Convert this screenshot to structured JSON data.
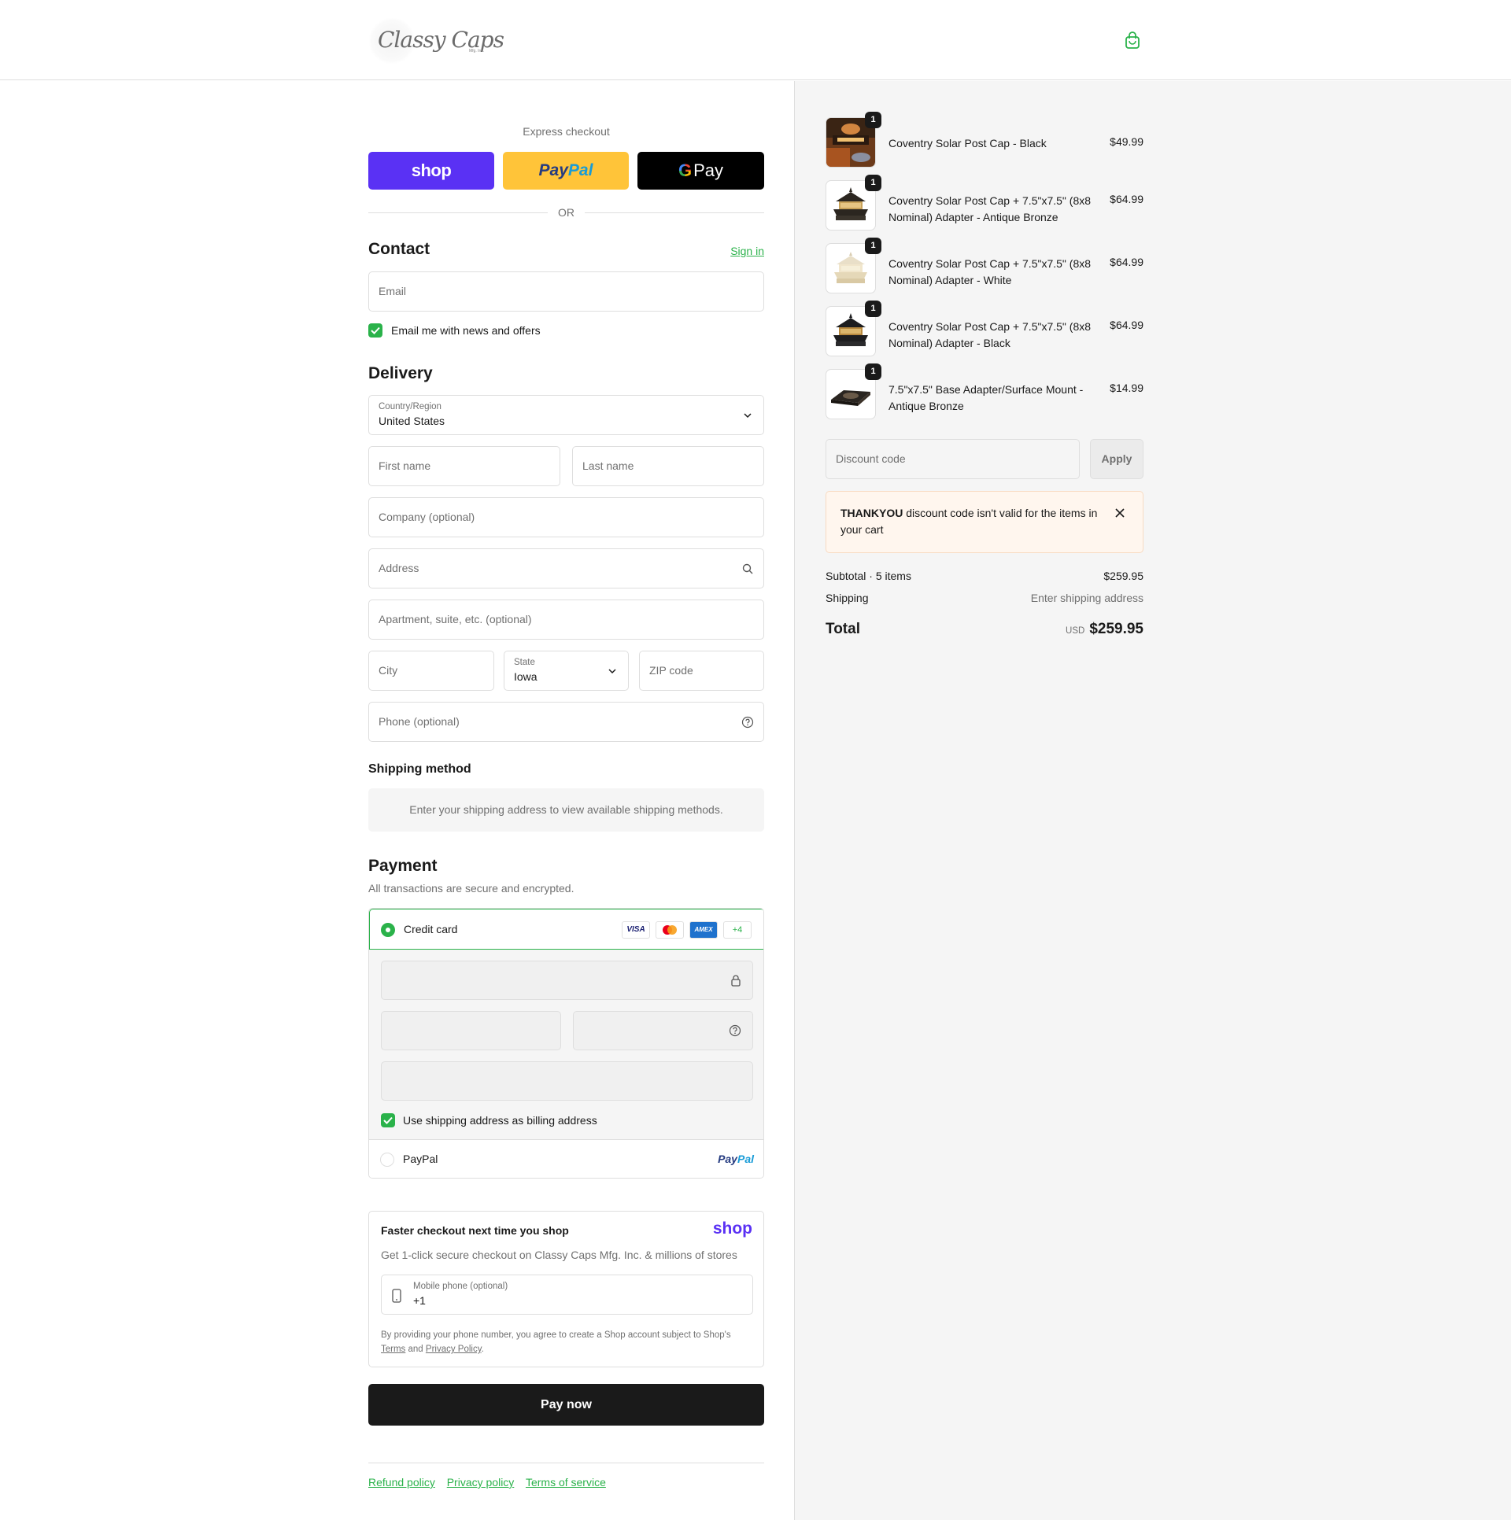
{
  "header": {
    "logo_text": "Classy Caps",
    "logo_small": "Mfg. Inc."
  },
  "express": {
    "label": "Express checkout",
    "shop_label": "shop",
    "paypal_label_1": "Pay",
    "paypal_label_2": "Pal",
    "gpay_g": "G",
    "gpay_label": "Pay",
    "or_label": "OR"
  },
  "contact": {
    "title": "Contact",
    "sign_in": "Sign in",
    "email_placeholder": "Email",
    "newsletter_label": "Email me with news and offers",
    "newsletter_checked": true
  },
  "delivery": {
    "title": "Delivery",
    "country_label": "Country/Region",
    "country_value": "United States",
    "first_name_placeholder": "First name",
    "last_name_placeholder": "Last name",
    "company_placeholder": "Company (optional)",
    "address_placeholder": "Address",
    "apartment_placeholder": "Apartment, suite, etc. (optional)",
    "city_placeholder": "City",
    "state_label": "State",
    "state_value": "Iowa",
    "zip_placeholder": "ZIP code",
    "phone_placeholder": "Phone (optional)"
  },
  "shipping": {
    "title": "Shipping method",
    "message": "Enter your shipping address to view available shipping methods."
  },
  "payment": {
    "title": "Payment",
    "subtitle": "All transactions are secure and encrypted.",
    "credit_card_label": "Credit card",
    "cards": [
      "VISA",
      "AMEX",
      "+4"
    ],
    "billing_label": "Use shipping address as billing address",
    "paypal_label": "PayPal",
    "paypal_logo_1": "Pay",
    "paypal_logo_2": "Pal"
  },
  "shop_pay": {
    "title": "Faster checkout next time you shop",
    "logo": "shop",
    "description": "Get 1-click secure checkout on Classy Caps Mfg. Inc. & millions of stores",
    "phone_label": "Mobile phone (optional)",
    "phone_value": "+1",
    "legal_1": "By providing your phone number, you agree to create a Shop account subject to Shop's",
    "legal_terms": "Terms",
    "legal_and": "and",
    "legal_privacy": "Privacy Policy",
    "legal_end": "."
  },
  "pay_now": "Pay now",
  "footer": {
    "links": [
      "Refund policy",
      "Privacy policy",
      "Terms of service"
    ]
  },
  "cart": {
    "items": [
      {
        "name": "Coventry Solar Post Cap - Black",
        "price": "$49.99",
        "qty": "1"
      },
      {
        "name": "Coventry Solar Post Cap + 7.5\"x7.5\" (8x8 Nominal) Adapter - Antique Bronze",
        "price": "$64.99",
        "qty": "1"
      },
      {
        "name": "Coventry Solar Post Cap + 7.5\"x7.5\" (8x8 Nominal) Adapter - White",
        "price": "$64.99",
        "qty": "1"
      },
      {
        "name": "Coventry Solar Post Cap + 7.5\"x7.5\" (8x8 Nominal) Adapter - Black",
        "price": "$64.99",
        "qty": "1"
      },
      {
        "name": "7.5\"x7.5\" Base Adapter/Surface Mount - Antique Bronze",
        "price": "$14.99",
        "qty": "1"
      }
    ],
    "discount_placeholder": "Discount code",
    "apply_label": "Apply",
    "alert_code": "THANKYOU",
    "alert_text": " discount code isn't valid for the items in your cart",
    "subtotal_label": "Subtotal · 5 items",
    "subtotal_value": "$259.95",
    "shipping_label": "Shipping",
    "shipping_value": "Enter shipping address",
    "total_label": "Total",
    "total_currency": "USD",
    "total_value": "$259.95"
  },
  "colors": {
    "accent": "#2ab24a",
    "shop_purple": "#5a31f4",
    "paypal_yellow": "#ffc439",
    "dark": "#1a1a1a"
  }
}
